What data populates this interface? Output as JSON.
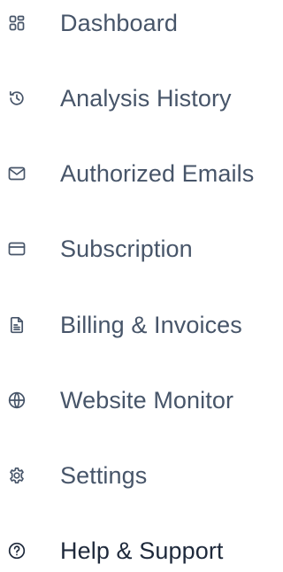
{
  "colors": {
    "muted_text": "#475569",
    "strong_text": "#1e293b",
    "background": "#ffffff"
  },
  "nav": {
    "items": [
      {
        "label": "Dashboard",
        "icon": "dashboard-grid-icon"
      },
      {
        "label": "Analysis History",
        "icon": "history-icon"
      },
      {
        "label": "Authorized Emails",
        "icon": "mail-icon"
      },
      {
        "label": "Subscription",
        "icon": "credit-card-icon"
      },
      {
        "label": "Billing & Invoices",
        "icon": "document-icon"
      },
      {
        "label": "Website Monitor",
        "icon": "globe-icon"
      },
      {
        "label": "Settings",
        "icon": "gear-icon"
      },
      {
        "label": "Help & Support",
        "icon": "help-circle-icon"
      }
    ]
  }
}
